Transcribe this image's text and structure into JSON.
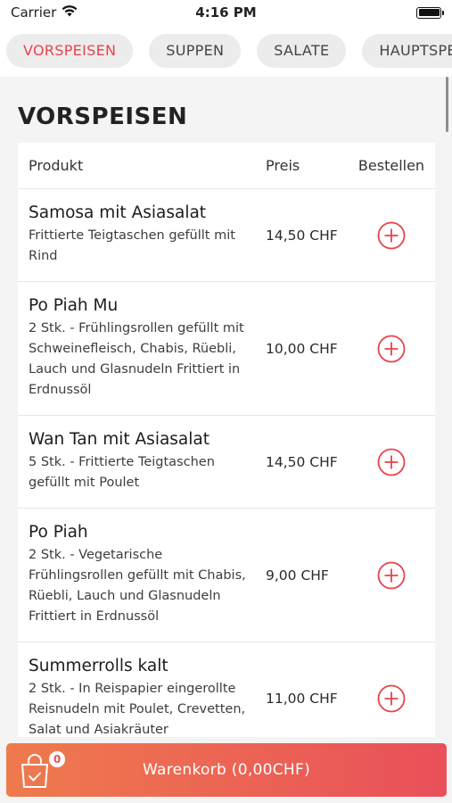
{
  "status_bar": {
    "carrier": "Carrier",
    "time": "4:16 PM"
  },
  "tabs": [
    {
      "label": "VORSPEISEN",
      "active": true
    },
    {
      "label": "SUPPEN",
      "active": false
    },
    {
      "label": "SALATE",
      "active": false
    },
    {
      "label": "HAUPTSPEISEN",
      "active": false
    }
  ],
  "section": {
    "title": "VORSPEISEN"
  },
  "table": {
    "headers": {
      "product": "Produkt",
      "price": "Preis",
      "order": "Bestellen"
    },
    "rows": [
      {
        "name": "Samosa mit Asiasalat",
        "description": "Frittierte Teigtaschen gefüllt mit Rind",
        "price": "14,50 CHF"
      },
      {
        "name": "Po Piah Mu",
        "description": "2 Stk. - Frühlingsrollen gefüllt mit Schweinefleisch, Chabis, Rüebli, Lauch und Glasnudeln Frittiert in Erdnussöl",
        "price": "10,00 CHF"
      },
      {
        "name": "Wan Tan mit Asiasalat",
        "description": "5 Stk. -  Frittierte Teigtaschen gefüllt mit Poulet",
        "price": "14,50 CHF"
      },
      {
        "name": "Po Piah",
        "description": "2 Stk. - Vegetarische Frühlingsrollen gefüllt mit Chabis, Rüebli, Lauch und Glasnudeln Frittiert in Erdnussöl",
        "price": "9,00 CHF"
      },
      {
        "name": "Summerrolls kalt",
        "description": "2 Stk. - In Reispapier eingerollte Reisnudeln mit Poulet, Crevetten, Salat und Asiakräuter",
        "price": "11,00 CHF"
      }
    ]
  },
  "cart": {
    "count": "0",
    "label": "Warenkorb (0,00CHF)"
  },
  "colors": {
    "accent": "#e8434a",
    "cart_gradient_start": "#ef7a4d",
    "cart_gradient_end": "#e9505a"
  },
  "icons": {
    "wifi": "wifi-icon",
    "battery": "battery-icon",
    "add": "plus-circle-icon",
    "cart": "shopping-bag-icon"
  }
}
